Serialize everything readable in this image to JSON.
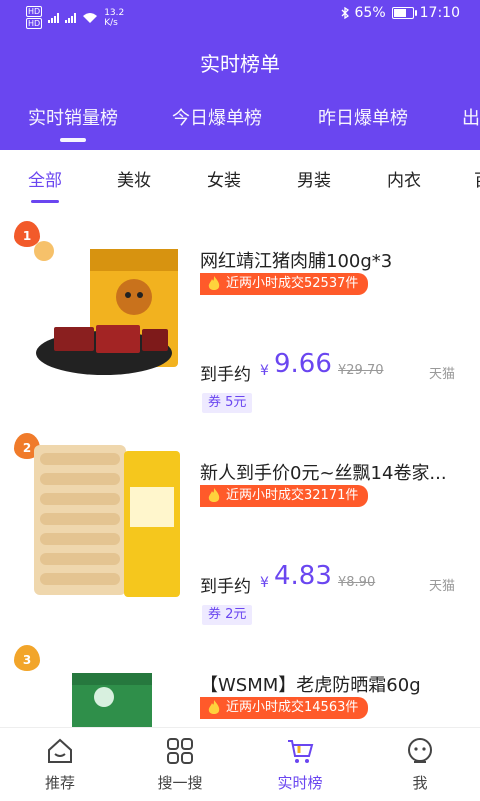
{
  "status_bar": {
    "speed_value": "13.2",
    "speed_unit": "K/s",
    "battery": "65%",
    "battery_level": 0.65,
    "time": "17:10"
  },
  "header": {
    "title": "实时榜单"
  },
  "top_tabs": [
    "实时销量榜",
    "今日爆单榜",
    "昨日爆单榜",
    "出"
  ],
  "categories": [
    "全部",
    "美妆",
    "女装",
    "男装",
    "内衣",
    "百"
  ],
  "products": [
    {
      "rank": "1",
      "rank_color": "#f25a2a",
      "name": "网红靖江猪肉脯100g*3",
      "sales": "近两小时成交52537件",
      "price_label": "到手约",
      "currency": "¥",
      "price": "9.66",
      "original": "¥29.70",
      "shop": "天猫",
      "coupon": "券 5元"
    },
    {
      "rank": "2",
      "rank_color": "#f07b2a",
      "name": "新人到手价0元~丝飘14卷家...",
      "sales": "近两小时成交32171件",
      "price_label": "到手约",
      "currency": "¥",
      "price": "4.83",
      "original": "¥8.90",
      "shop": "天猫",
      "coupon": "券 2元"
    },
    {
      "rank": "3",
      "rank_color": "#f2a52a",
      "name": "【WSMM】老虎防晒霜60g",
      "sales": "近两小时成交14563件"
    }
  ],
  "tab_bar": [
    {
      "label": "推荐",
      "icon": "home-icon"
    },
    {
      "label": "搜一搜",
      "icon": "grid-icon"
    },
    {
      "label": "实时榜",
      "icon": "cart-icon"
    },
    {
      "label": "我",
      "icon": "face-icon"
    }
  ],
  "colors": {
    "brand": "#6a46f0",
    "sales_badge": "#ff5a2a"
  }
}
